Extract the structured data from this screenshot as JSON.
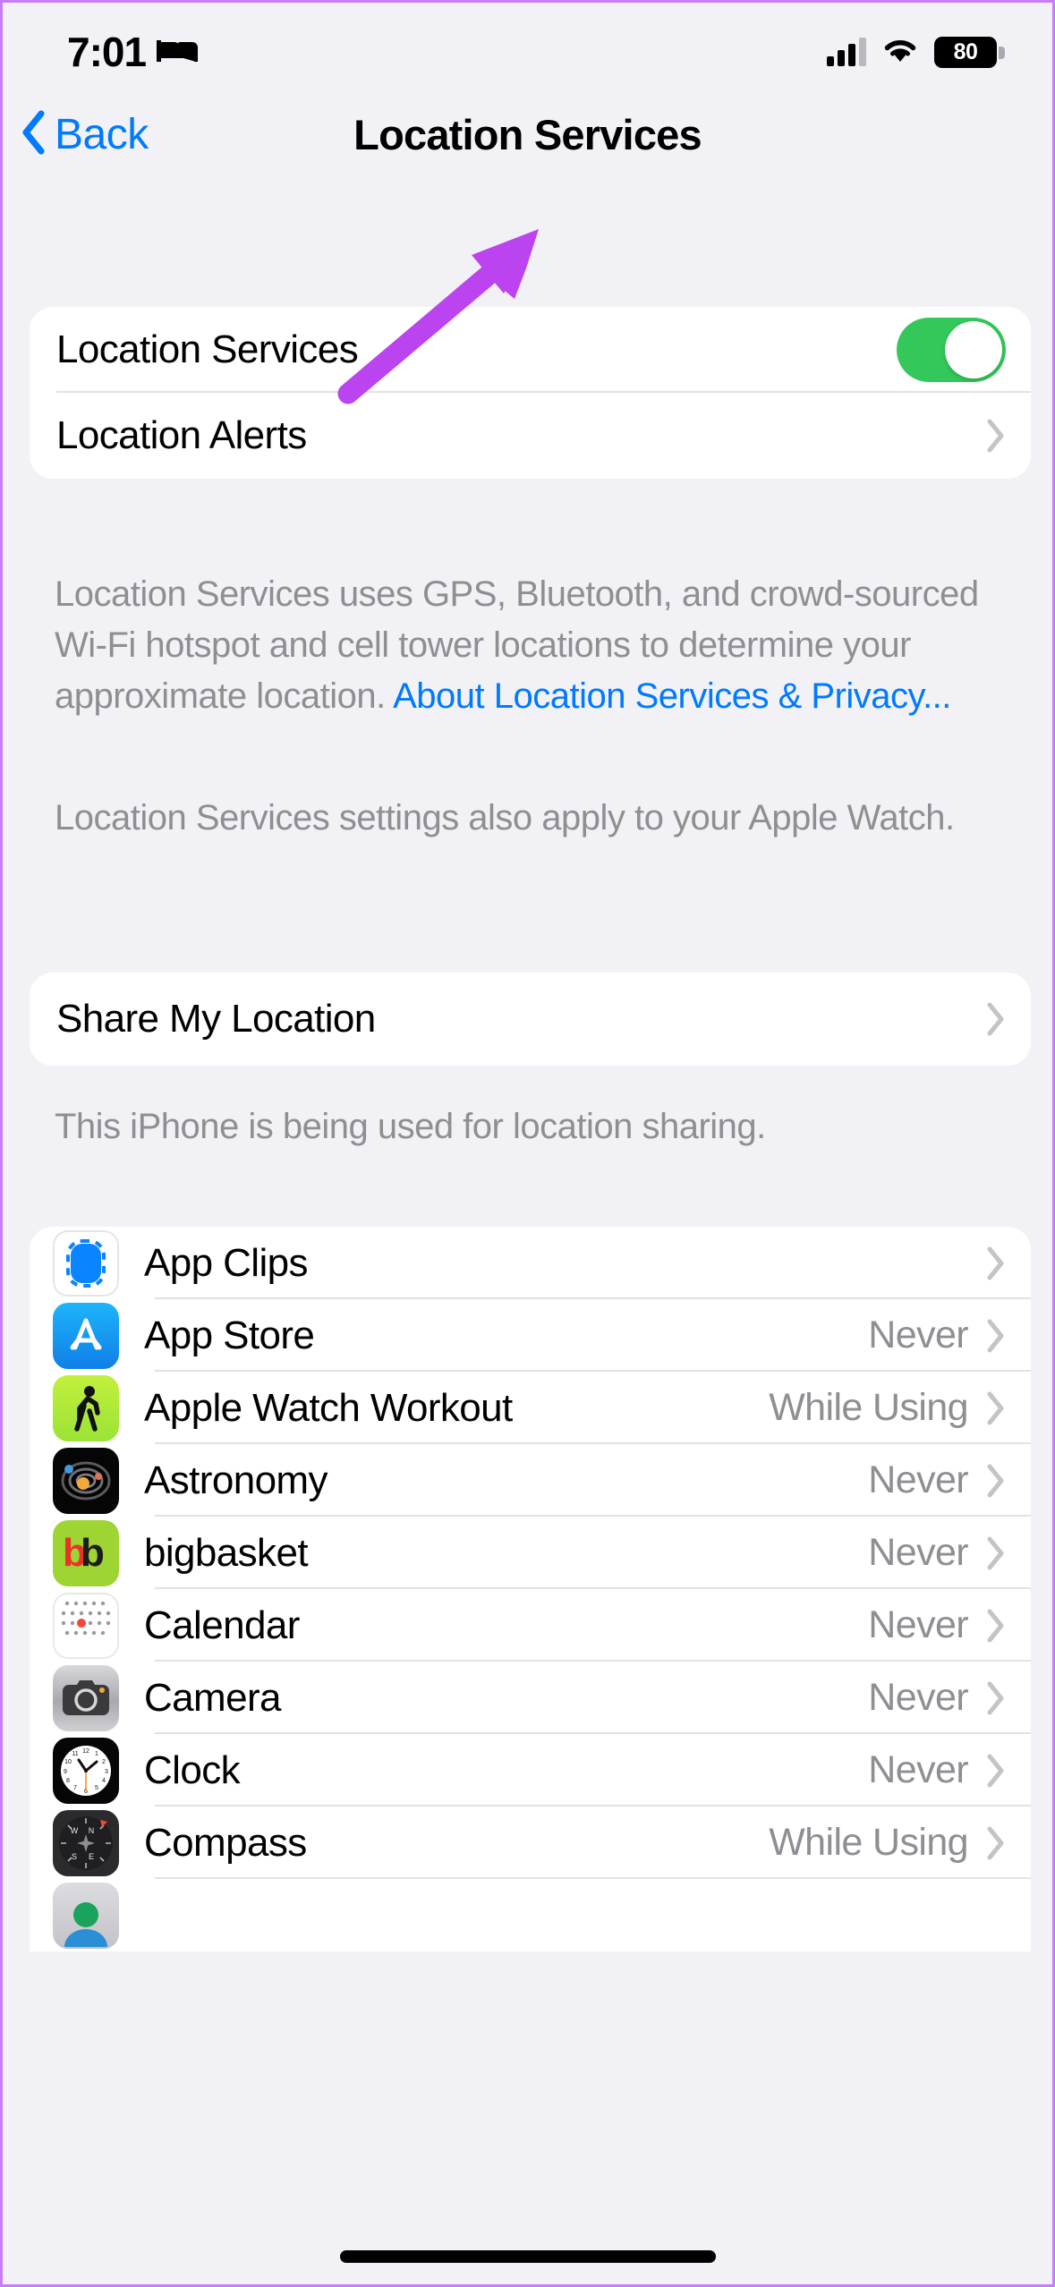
{
  "status_bar": {
    "time": "7:01",
    "sleep_focus_icon": "bed-icon",
    "cellular_icon": "cellular-bars-icon",
    "wifi_icon": "wifi-icon",
    "battery_percent": "80"
  },
  "nav": {
    "back_label": "Back",
    "back_icon": "chevron-left-icon",
    "title": "Location Services"
  },
  "main_card": {
    "location_services": {
      "label": "Location Services",
      "toggle_state": "on",
      "toggle_color": "#34c759"
    },
    "location_alerts": {
      "label": "Location Alerts"
    }
  },
  "footer_one": {
    "text": "Location Services uses GPS, Bluetooth, and crowd-sourced Wi-Fi hotspot and cell tower locations to determine your approximate location. ",
    "link": "About Location Services & Privacy..."
  },
  "footer_two": {
    "text": "Location Services settings also apply to your Apple Watch."
  },
  "share_card": {
    "label": "Share My Location"
  },
  "footer_three": {
    "text": "This iPhone is being used for location sharing."
  },
  "apps": [
    {
      "name": "App Clips",
      "status": "",
      "icon": "app-clips-icon"
    },
    {
      "name": "App Store",
      "status": "Never",
      "icon": "app-store-icon"
    },
    {
      "name": "Apple Watch Workout",
      "status": "While Using",
      "icon": "workout-icon"
    },
    {
      "name": "Astronomy",
      "status": "Never",
      "icon": "astronomy-icon"
    },
    {
      "name": "bigbasket",
      "status": "Never",
      "icon": "bigbasket-icon"
    },
    {
      "name": "Calendar",
      "status": "Never",
      "icon": "calendar-icon"
    },
    {
      "name": "Camera",
      "status": "Never",
      "icon": "camera-icon"
    },
    {
      "name": "Clock",
      "status": "Never",
      "icon": "clock-icon"
    },
    {
      "name": "Compass",
      "status": "While Using",
      "icon": "compass-icon"
    }
  ],
  "annotation": {
    "type": "arrow",
    "color": "#bb44f0",
    "points_at": "location-services-toggle"
  },
  "colors": {
    "accent_blue": "#007aff",
    "toggle_green": "#34c759",
    "secondary_text": "#8e8e93",
    "page_background": "#f2f1f6"
  }
}
